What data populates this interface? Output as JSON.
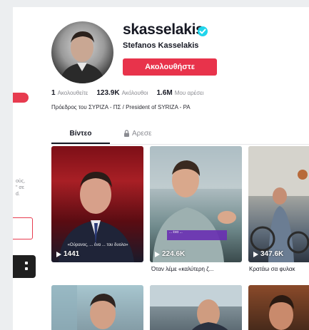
{
  "profile": {
    "username": "skasselakis",
    "full_name": "Stefanos Kasselakis",
    "follow_label": "Ακολουθήστε",
    "bio": "Πρόεδρος του ΣΥΡΙΖΑ - ΠΣ / President of SYRIZA - PA"
  },
  "stats": [
    {
      "value": "1",
      "label": "Ακολουθείτε"
    },
    {
      "value": "123.9K",
      "label": "Ακόλουθοι"
    },
    {
      "value": "1.6M",
      "label": "Μου αρέσει"
    }
  ],
  "tabs": {
    "videos": "Βίντεο",
    "liked": "Αρεσε"
  },
  "videos": [
    {
      "views": "1441",
      "overlay_text": "«Ούρανος, ... ένα ... του δυολο»"
    },
    {
      "views": "224.6K",
      "overlay_text": "... ένα ...",
      "description": "Όταν λέμε «καλύτερη ζ..."
    },
    {
      "views": "347.6K",
      "description": "Κρατάω σα φυλακ"
    }
  ],
  "left_fragment": {
    "lines": "ούς,\n\" σε\nd."
  },
  "colors": {
    "accent": "#e8334b",
    "verified": "#20d5ec",
    "text_primary": "#161823",
    "text_secondary": "#8a8b91"
  },
  "icons": {
    "verified": "verified-check-icon",
    "lock": "lock-icon",
    "play": "play-icon"
  }
}
